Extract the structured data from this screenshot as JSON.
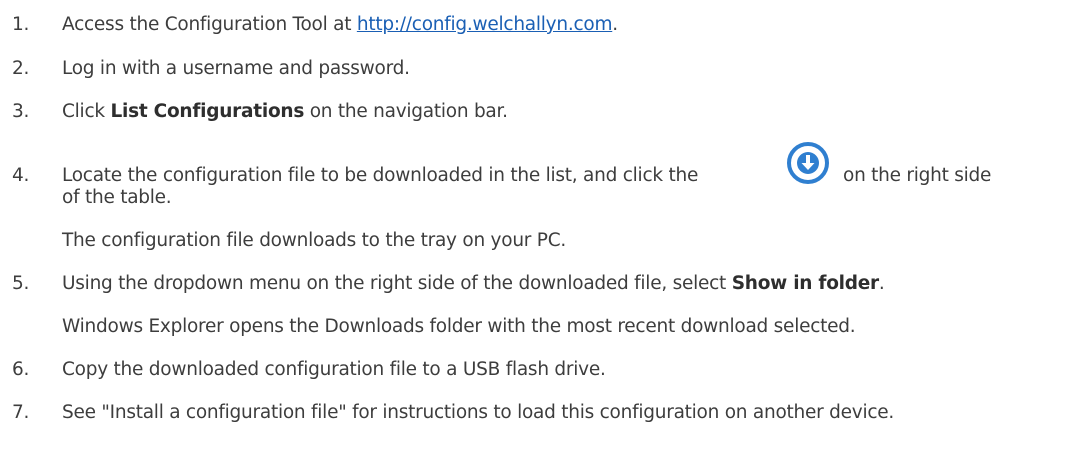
{
  "steps": [
    {
      "number": "1.",
      "text_before": "Access the Configuration Tool at ",
      "link": "http://config.welchallyn.com",
      "text_after": "."
    },
    {
      "number": "2.",
      "text": "Log in with a username and password."
    },
    {
      "number": "3.",
      "text_before": "Click ",
      "bold": "List Configurations",
      "text_after": " on the navigation bar."
    },
    {
      "number": "4.",
      "text_before": "Locate the configuration file to be downloaded in the list, and click the",
      "text_after": "on the right side",
      "text_line2": "of the table.",
      "icon": "download-circle-icon",
      "result": "The configuration file downloads to the tray on your PC."
    },
    {
      "number": "5.",
      "text_before": "Using the dropdown menu on the right side of the downloaded file, select ",
      "bold": "Show in folder",
      "text_after": ".",
      "result": "Windows Explorer opens the Downloads folder with the most recent download selected."
    },
    {
      "number": "6.",
      "text": "Copy the downloaded configuration file to a USB flash drive."
    },
    {
      "number": "7.",
      "text": "See \"Install a configuration file\" for instructions to load this configuration on another device."
    }
  ],
  "colors": {
    "text": "#3d3d3d",
    "link": "#1a5fb4",
    "icon": "#2f7fd0"
  }
}
